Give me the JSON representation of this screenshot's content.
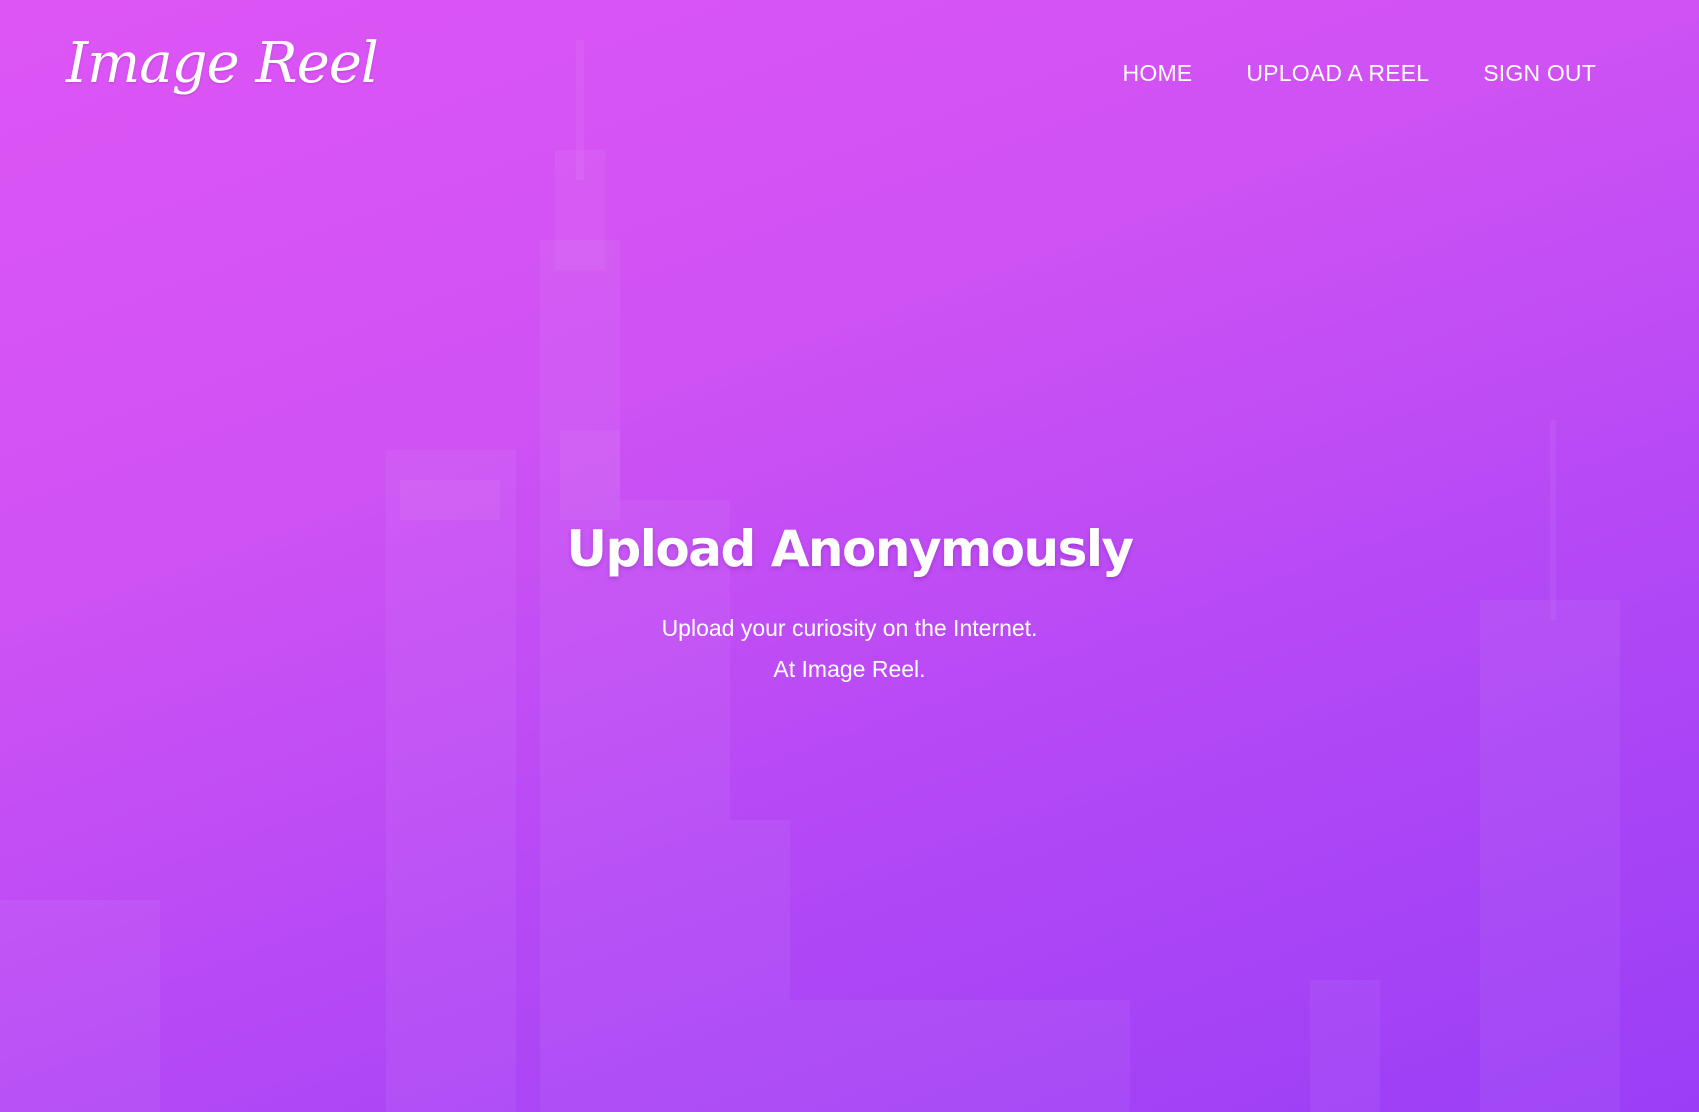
{
  "brand": {
    "name": "Image Reel"
  },
  "nav": {
    "items": [
      {
        "label": "HOME"
      },
      {
        "label": "UPLOAD A REEL"
      },
      {
        "label": "SIGN OUT"
      }
    ]
  },
  "hero": {
    "title": "Upload Anonymously",
    "subtitle_line1": "Upload your curiosity on the Internet.",
    "subtitle_line2": "At Image Reel."
  },
  "colors": {
    "gradient_start": "#de55f5",
    "gradient_end": "#9a3ef6",
    "text": "#ffffff"
  }
}
